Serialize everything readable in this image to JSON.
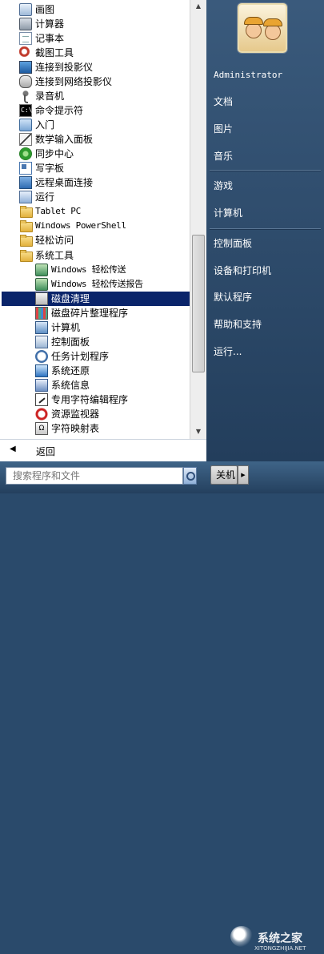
{
  "programs": [
    {
      "label": "画图",
      "icon": "paint-icon",
      "cls": "ic-app",
      "indent": 1
    },
    {
      "label": "计算器",
      "icon": "calculator-icon",
      "cls": "ic-calc",
      "indent": 1
    },
    {
      "label": "记事本",
      "icon": "notepad-icon",
      "cls": "ic-doc",
      "indent": 1
    },
    {
      "label": "截图工具",
      "icon": "snipping-tool-icon",
      "cls": "ic-snip",
      "indent": 1
    },
    {
      "label": "连接到投影仪",
      "icon": "projector-monitor-icon",
      "cls": "ic-monitor",
      "indent": 1
    },
    {
      "label": "连接到网络投影仪",
      "icon": "network-projector-icon",
      "cls": "ic-proj",
      "indent": 1
    },
    {
      "label": "录音机",
      "icon": "microphone-icon",
      "cls": "ic-mic",
      "indent": 1
    },
    {
      "label": "命令提示符",
      "icon": "command-prompt-icon",
      "cls": "ic-cmd",
      "indent": 1
    },
    {
      "label": "入门",
      "icon": "getting-started-icon",
      "cls": "ic-help",
      "indent": 1
    },
    {
      "label": "数学输入面板",
      "icon": "math-input-icon",
      "cls": "ic-pen",
      "indent": 1
    },
    {
      "label": "同步中心",
      "icon": "sync-center-icon",
      "cls": "ic-sync",
      "indent": 1
    },
    {
      "label": "写字板",
      "icon": "wordpad-icon",
      "cls": "ic-wordpad",
      "indent": 1
    },
    {
      "label": "远程桌面连接",
      "icon": "remote-desktop-icon",
      "cls": "ic-rdp",
      "indent": 1
    },
    {
      "label": "运行",
      "icon": "run-icon",
      "cls": "ic-run",
      "indent": 1
    },
    {
      "label": "Tablet PC",
      "icon": "folder-icon",
      "cls": "ic-folder",
      "indent": 1,
      "mono": true
    },
    {
      "label": "Windows PowerShell",
      "icon": "folder-icon",
      "cls": "ic-folder",
      "indent": 1,
      "mono": true
    },
    {
      "label": "轻松访问",
      "icon": "folder-icon",
      "cls": "ic-folder",
      "indent": 1
    },
    {
      "label": "系统工具",
      "icon": "folder-icon",
      "cls": "ic-folder",
      "indent": 1
    },
    {
      "label": "Windows 轻松传送",
      "icon": "easy-transfer-icon",
      "cls": "ic-transfer",
      "indent": 2,
      "mono": true
    },
    {
      "label": "Windows 轻松传送报告",
      "icon": "easy-transfer-report-icon",
      "cls": "ic-transfer",
      "indent": 2,
      "mono": true
    },
    {
      "label": "磁盘清理",
      "icon": "disk-cleanup-icon",
      "cls": "ic-disk",
      "indent": 2,
      "selected": true
    },
    {
      "label": "磁盘碎片整理程序",
      "icon": "defragmenter-icon",
      "cls": "ic-defrag",
      "indent": 2
    },
    {
      "label": "计算机",
      "icon": "computer-icon",
      "cls": "ic-pc",
      "indent": 2
    },
    {
      "label": "控制面板",
      "icon": "control-panel-icon",
      "cls": "ic-cp",
      "indent": 2
    },
    {
      "label": "任务计划程序",
      "icon": "task-scheduler-icon",
      "cls": "ic-clock",
      "indent": 2
    },
    {
      "label": "系统还原",
      "icon": "system-restore-icon",
      "cls": "ic-restore",
      "indent": 2
    },
    {
      "label": "系统信息",
      "icon": "system-info-icon",
      "cls": "ic-info",
      "indent": 2
    },
    {
      "label": "专用字符编辑程序",
      "icon": "char-editor-icon",
      "cls": "ic-char",
      "indent": 2
    },
    {
      "label": "资源监视器",
      "icon": "resource-monitor-icon",
      "cls": "ic-noentry",
      "indent": 2
    },
    {
      "label": "字符映射表",
      "icon": "character-map-icon",
      "cls": "ic-charmap",
      "indent": 2
    }
  ],
  "back_label": "返回",
  "search": {
    "placeholder": "搜索程序和文件"
  },
  "user_name": "Administrator",
  "right_menu": [
    {
      "label": "文档",
      "name": "documents"
    },
    {
      "label": "图片",
      "name": "pictures"
    },
    {
      "label": "音乐",
      "name": "music"
    },
    {
      "sep": true
    },
    {
      "label": "游戏",
      "name": "games"
    },
    {
      "label": "计算机",
      "name": "computer"
    },
    {
      "sep": true
    },
    {
      "label": "控制面板",
      "name": "control-panel"
    },
    {
      "label": "设备和打印机",
      "name": "devices-printers"
    },
    {
      "label": "默认程序",
      "name": "default-programs"
    },
    {
      "label": "帮助和支持",
      "name": "help-support"
    },
    {
      "label": "运行...",
      "name": "run"
    }
  ],
  "shutdown_label": "关机",
  "watermark": {
    "main": "系统之家",
    "sub": "XITONGZHIJIA.NET"
  }
}
